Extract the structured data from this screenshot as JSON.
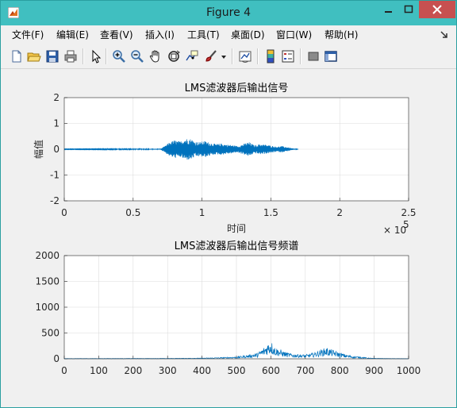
{
  "window": {
    "title": "Figure 4",
    "colors": {
      "titlebar": "#40bfc0",
      "close": "#c75050",
      "plot_line": "#0072bd"
    }
  },
  "menu": [
    {
      "id": "file",
      "label": "文件(F)"
    },
    {
      "id": "edit",
      "label": "编辑(E)"
    },
    {
      "id": "view",
      "label": "查看(V)"
    },
    {
      "id": "insert",
      "label": "插入(I)"
    },
    {
      "id": "tools",
      "label": "工具(T)"
    },
    {
      "id": "desktop",
      "label": "桌面(D)"
    },
    {
      "id": "window",
      "label": "窗口(W)"
    },
    {
      "id": "help",
      "label": "帮助(H)"
    }
  ],
  "toolbar_icons": [
    "new-figure-icon",
    "open-file-icon",
    "save-icon",
    "print-icon",
    "edit-plot-arrow-icon",
    "zoom-in-icon",
    "zoom-out-icon",
    "pan-hand-icon",
    "rotate-3d-icon",
    "data-cursor-icon",
    "brush-icon",
    "dropdown-arrow-icon",
    "link-plot-icon",
    "colorbar-icon",
    "legend-icon",
    "hide-plot-tools-icon",
    "show-plot-tools-icon"
  ],
  "chart_data": [
    {
      "type": "line",
      "title": "LMS滤波器后输出信号",
      "xlabel": "时间",
      "ylabel": "幅值",
      "xlim": [
        0,
        250000
      ],
      "ylim": [
        -2,
        2
      ],
      "x_ticks": [
        "0",
        "0.5",
        "1",
        "1.5",
        "2",
        "2.5"
      ],
      "y_ticks": [
        "-2",
        "-1",
        "0",
        "1",
        "2"
      ],
      "x_exponent_base": "× 10",
      "x_exponent_power": "5",
      "grid": true,
      "envelope": {
        "x": [
          0,
          70000,
          73000,
          76000,
          80000,
          84000,
          88000,
          92000,
          95000,
          98000,
          102000,
          106000,
          110000,
          114000,
          118000,
          122000,
          126000,
          130000,
          134000,
          138000,
          142000,
          146000,
          150000,
          154000,
          158000,
          162000,
          165000,
          170000
        ],
        "amplitude": [
          0.01,
          0.02,
          0.12,
          0.25,
          0.35,
          0.3,
          0.42,
          0.4,
          0.3,
          0.28,
          0.32,
          0.25,
          0.2,
          0.22,
          0.18,
          0.16,
          0.12,
          0.2,
          0.28,
          0.15,
          0.2,
          0.18,
          0.14,
          0.1,
          0.12,
          0.08,
          0.04,
          0.0
        ]
      }
    },
    {
      "type": "line",
      "title": "LMS滤波器后输出信号频谱",
      "xlim": [
        0,
        1000
      ],
      "ylim": [
        0,
        2000
      ],
      "x_ticks": [
        "0",
        "100",
        "200",
        "300",
        "400",
        "500",
        "600",
        "700",
        "800",
        "900",
        "1000"
      ],
      "y_ticks": [
        "0",
        "500",
        "1000",
        "1500",
        "2000"
      ],
      "grid": true,
      "envelope": {
        "x": [
          0,
          300,
          400,
          450,
          500,
          530,
          560,
          580,
          590,
          600,
          610,
          620,
          640,
          660,
          680,
          700,
          720,
          740,
          760,
          770,
          780,
          800,
          820,
          840,
          860,
          880,
          900,
          950,
          1000
        ],
        "amplitude": [
          5,
          8,
          15,
          25,
          40,
          70,
          110,
          220,
          300,
          360,
          240,
          200,
          140,
          100,
          90,
          80,
          110,
          160,
          220,
          200,
          170,
          120,
          80,
          50,
          40,
          20,
          10,
          5,
          3
        ]
      }
    }
  ]
}
